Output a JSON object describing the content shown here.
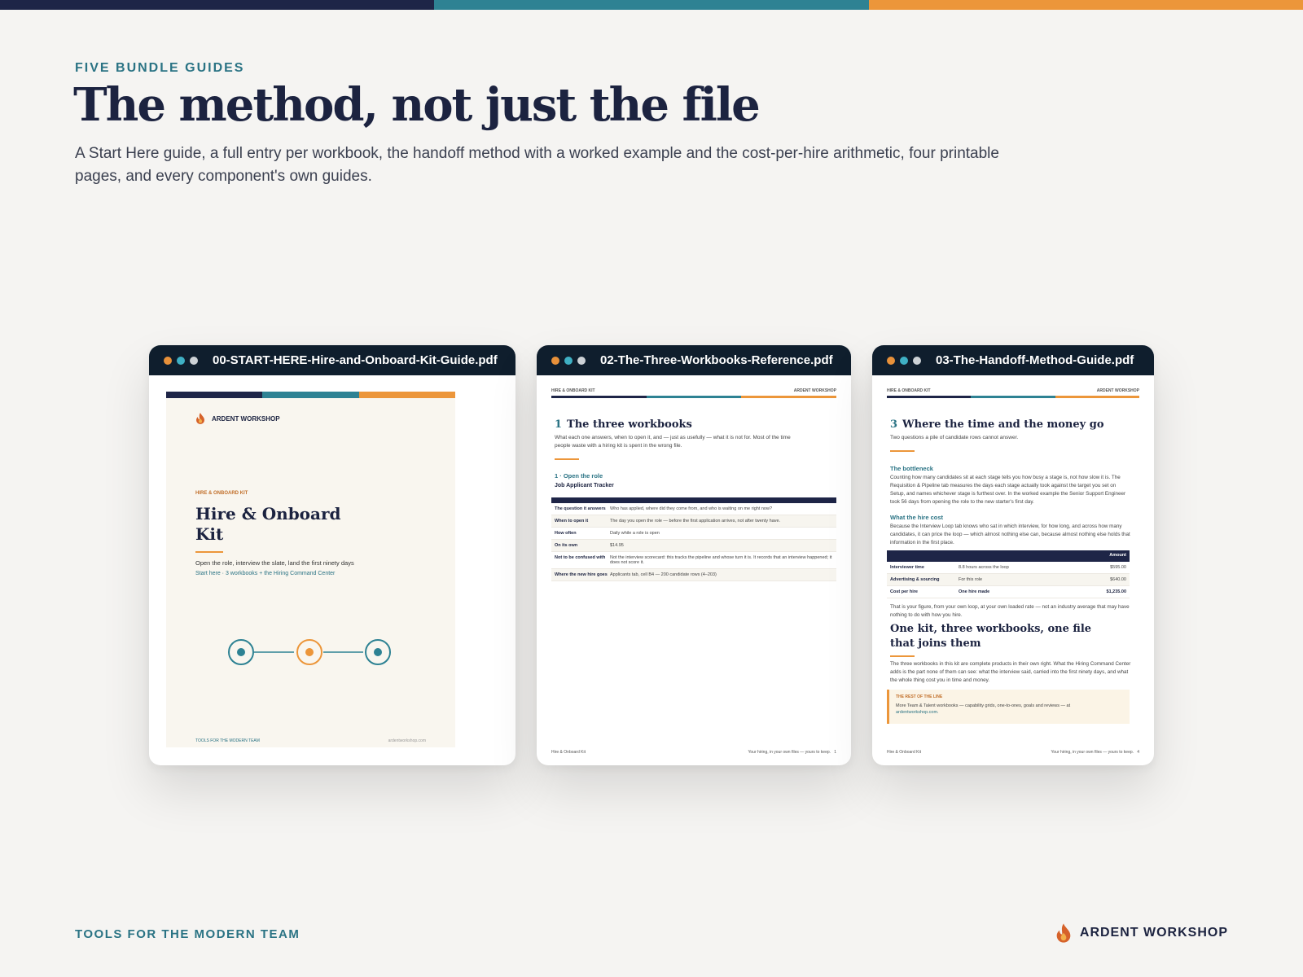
{
  "colors": {
    "navy": "#1e2547",
    "teal": "#2e8293",
    "orange": "#ec963a",
    "background": "#f5f4f2"
  },
  "header": {
    "eyebrow": "FIVE BUNDLE GUIDES",
    "title": "The method, not just the file",
    "subtitle": "A Start Here guide, a full entry per workbook, the handoff method with a worked example and the cost-per-hire arithmetic, four printable pages, and every component's own guides."
  },
  "windows": [
    {
      "filename": "00-START-HERE-Hire-and-Onboard-Kit-Guide.pdf"
    },
    {
      "filename": "02-The-Three-Workbooks-Reference.pdf"
    },
    {
      "filename": "03-The-Handoff-Method-Guide.pdf"
    }
  ],
  "cover": {
    "logo_icon": "flame-icon",
    "brand": "ARDENT WORKSHOP",
    "tag": "HIRE & ONBOARD KIT",
    "title": "Hire & Onboard Kit",
    "desc": "Open the role, interview the slate, land the first ninety days",
    "link": "Start here · 3 workbooks + the Hiring Command Center",
    "footer_left": "TOOLS FOR THE MODERN TEAM",
    "footer_right": "ardentworkshop.com"
  },
  "page2": {
    "header_left": "HIRE & ONBOARD KIT",
    "header_right": "ARDENT WORKSHOP",
    "section_num": "1",
    "section_title": "The three workbooks",
    "section_sub": "What each one answers, when to open it, and — just as usefully — what it is not for. Most of the time people waste with a hiring kit is spent in the wrong file.",
    "subhead": "1 · Open the role",
    "workbook": "Job Applicant Tracker",
    "rows": [
      {
        "k": "The question it answers",
        "v": "Who has applied, where did they come from, and who is waiting on me right now?"
      },
      {
        "k": "When to open it",
        "v": "The day you open the role — before the first application arrives, not after twenty have."
      },
      {
        "k": "How often",
        "v": "Daily while a role is open"
      },
      {
        "k": "On its own",
        "v": "$14.95"
      },
      {
        "k": "Not to be confused with",
        "v": "Not the interview scorecard: this tracks the pipeline and whose turn it is. It records that an interview happened; it does not score it."
      },
      {
        "k": "Where the new hire goes",
        "v": "Applicants tab, cell B4 — 200 candidate rows (4–203)"
      }
    ],
    "footer_left": "Hire & Onboard Kit",
    "footer_mid": "Your hiring, in your own files — yours to keep.",
    "footer_page": "1"
  },
  "page3": {
    "header_left": "HIRE & ONBOARD KIT",
    "header_right": "ARDENT WORKSHOP",
    "section_num": "3",
    "section_title": "Where the time and the money go",
    "section_sub": "Two questions a pile of candidate rows cannot answer.",
    "h_bottleneck": "The bottleneck",
    "p_bottleneck": "Counting how many candidates sit at each stage tells you how busy a stage is, not how slow it is. The Requisition & Pipeline tab measures the days each stage actually took against the target you set on Setup, and names whichever stage is furthest over. In the worked example the Senior Support Engineer took 56 days from opening the role to the new starter's first day.",
    "h_cost": "What the hire cost",
    "p_cost": "Because the Interview Loop tab knows who sat in which interview, for how long, and across how many candidates, it can price the loop — which almost nothing else can, because almost nothing else holds that information in the first place.",
    "table_header": "Amount",
    "table_rows": [
      {
        "c1": "Interviewer time",
        "c2": "8.8 hours across the loop",
        "c3": "$595.00"
      },
      {
        "c1": "Advertising & sourcing",
        "c2": "For this role",
        "c3": "$640.00"
      },
      {
        "c1": "Cost per hire",
        "c2": "One hire made",
        "c3": "$1,235.00"
      }
    ],
    "p_after": "That is your figure, from your own loop, at your own loaded rate — not an industry average that may have nothing to do with how you hire.",
    "h2": "One kit, three workbooks, one file that joins them",
    "p_kit": "The three workbooks in this kit are complete products in their own right. What the Hiring Command Center adds is the part none of them can see: what the interview said, carried into the first ninety days, and what the whole thing cost you in time and money.",
    "callout_title": "THE REST OF THE LINE",
    "callout_body": "More Team & Talent workbooks — capability grids, one-to-ones, goals and reviews — at",
    "callout_link": "ardentworkshop.com.",
    "footer_left": "Hire & Onboard Kit",
    "footer_mid": "Your hiring, in your own files — yours to keep.",
    "footer_page": "4"
  },
  "footer": {
    "left": "TOOLS FOR THE MODERN TEAM",
    "brand": "ARDENT WORKSHOP",
    "icon": "flame-icon"
  }
}
